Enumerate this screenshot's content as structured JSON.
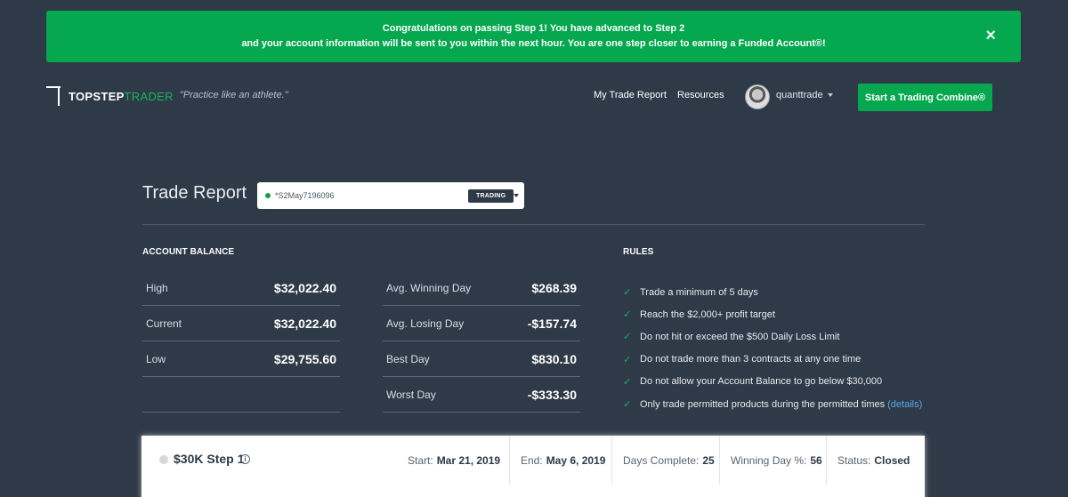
{
  "banner": {
    "line1": "Congratulations on passing Step 1! You have advanced to Step 2",
    "line2": "and your account information will be sent to you within the next hour. You are one step closer to earning a Funded Account®!",
    "close": "×"
  },
  "header": {
    "logo_part1": "TOPSTEP",
    "logo_part2": "TRADER",
    "tagline": "\"Practice like an athlete.\"",
    "nav": [
      "My Trade Report",
      "Resources"
    ],
    "username": "quanttrade",
    "cta": "Start a Trading Combine®"
  },
  "report": {
    "title": "Trade Report",
    "account_id": "*S2May7196096",
    "account_status": "TRADING"
  },
  "balance": {
    "heading": "ACCOUNT BALANCE",
    "rows": [
      {
        "label": "High",
        "value": "$32,022.40"
      },
      {
        "label": "Current",
        "value": "$32,022.40"
      },
      {
        "label": "Low",
        "value": "$29,755.60"
      }
    ]
  },
  "days": {
    "rows": [
      {
        "label": "Avg. Winning Day",
        "value": "$268.39"
      },
      {
        "label": "Avg. Losing Day",
        "value": "-$157.74"
      },
      {
        "label": "Best Day",
        "value": "$830.10"
      },
      {
        "label": "Worst Day",
        "value": "-$333.30"
      }
    ]
  },
  "rules": {
    "heading": "RULES",
    "items": [
      "Trade a minimum of 5 days",
      "Reach the $2,000+ profit target",
      "Do not hit or exceed the $500 Daily Loss Limit",
      "Do not trade more than 3 contracts at any one time",
      "Do not allow your Account Balance to go below $30,000",
      "Only trade permitted products during the permitted times"
    ],
    "details_link": "(details)"
  },
  "step_card": {
    "title": "$30K Step 1",
    "info_icon": "i",
    "start_label": "Start:",
    "start_value": "Mar 21, 2019",
    "end_label": "End:",
    "end_value": "May 6, 2019",
    "days_label": "Days Complete:",
    "days_value": "25",
    "win_label": "Winning Day %:",
    "win_value": "56",
    "status_label": "Status:",
    "status_value": "Closed"
  },
  "colors": {
    "background": "#2e3a48",
    "accent_green": "#05a74f",
    "link_blue": "#5aa9e6"
  }
}
